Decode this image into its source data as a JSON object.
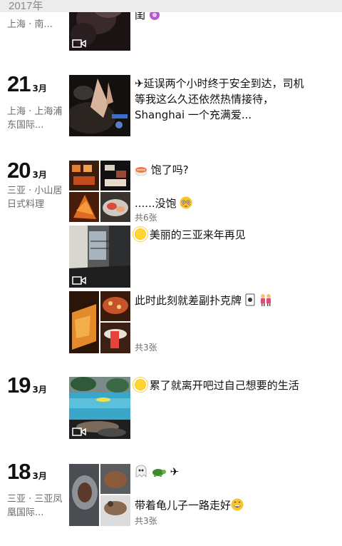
{
  "year": "2017年",
  "entries": [
    {
      "day": "",
      "month": "",
      "location": "上海 · 南...",
      "posts": [
        {
          "text": "闺",
          "media": "video"
        }
      ]
    },
    {
      "day": "21",
      "month": "3月",
      "location": "上海 · 上海浦东国际...",
      "posts": [
        {
          "text": "✈延误两个小时终于安全到达，司机等我这么久还依然热情接待，Shanghai 一个充满爱...",
          "media": "photo"
        }
      ]
    },
    {
      "day": "20",
      "month": "3月",
      "location": "三亚 · 小山居日式料理",
      "posts": [
        {
          "emoji": "sushi-icon",
          "text": " 饱了吗?",
          "text2": "......没饱",
          "emoji2": "flushed-face-icon",
          "count": "共6张",
          "media": "grid"
        },
        {
          "emoji": "sun-icon",
          "text": " 美丽的三亚来年再见",
          "media": "video"
        },
        {
          "text": "此时此刻就差副扑克牌",
          "emoji": "playing-card-icon",
          "emoji2": "two-women-icon",
          "count": "共3张",
          "media": "grid"
        }
      ]
    },
    {
      "day": "19",
      "month": "3月",
      "location": "",
      "posts": [
        {
          "emoji": "sun-icon",
          "text": " 累了就离开吧过自己想要的生活",
          "media": "video"
        }
      ]
    },
    {
      "day": "18",
      "month": "3月",
      "location": "三亚 · 三亚凤凰国际...",
      "posts": [
        {
          "emoji": "ghost-icon",
          "emoji2": "turtle-icon",
          "emoji3": "airplane-icon",
          "text": "✈",
          "text2": "带着龟儿子一路走好",
          "emoji4": "grinning-face-icon",
          "count": "共3张",
          "media": "grid"
        }
      ]
    }
  ],
  "colors": {
    "yearbar": "#ececec",
    "location_text": "#6b6b6b",
    "count_text": "#6e6e6e"
  }
}
